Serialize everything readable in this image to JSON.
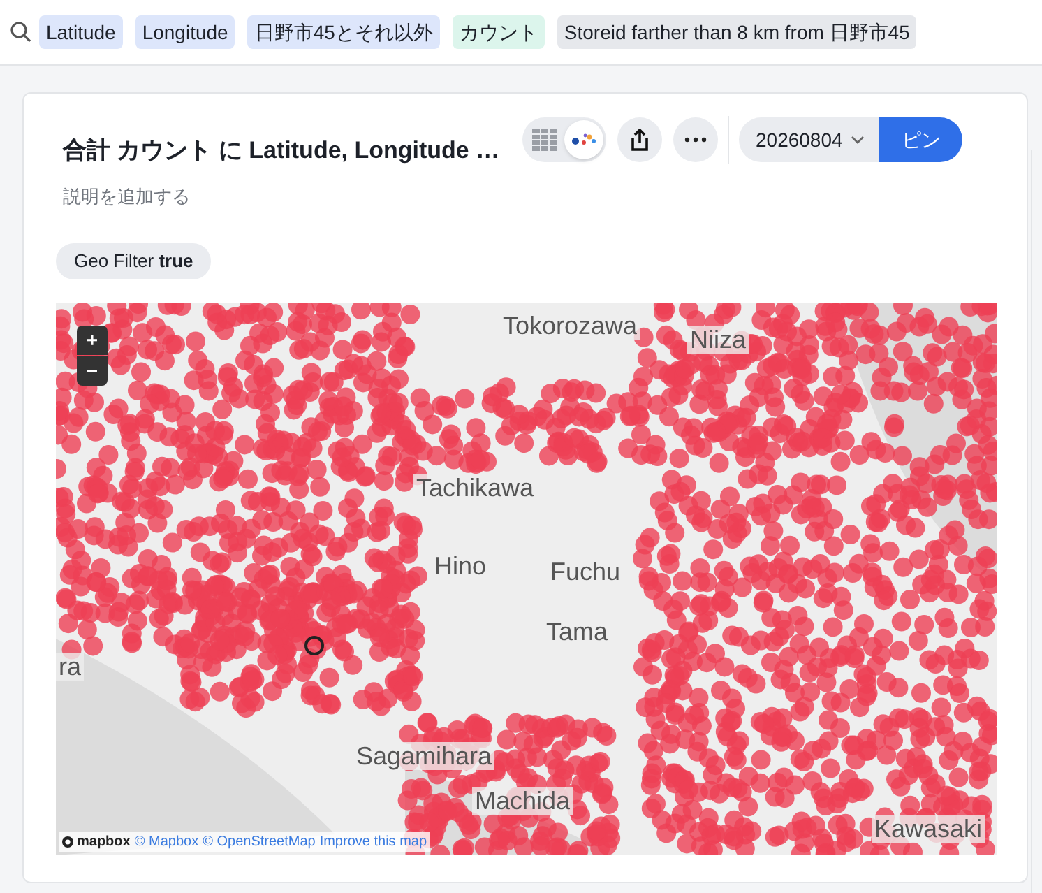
{
  "search_tokens": [
    {
      "label": "Latitude",
      "kind": "column"
    },
    {
      "label": "Longitude",
      "kind": "column"
    },
    {
      "label": "日野市45とそれ以外",
      "kind": "column"
    },
    {
      "label": "カウント",
      "kind": "measure"
    },
    {
      "label": "Storeid farther than 8 km from 日野市45",
      "kind": "filter"
    }
  ],
  "card": {
    "title": "合計 カウント に Latitude, Longitude …",
    "description_placeholder": "説明を追加する",
    "view_toggle": [
      {
        "kind": "table",
        "selected": false
      },
      {
        "kind": "map",
        "selected": true
      }
    ],
    "version": "20260804",
    "pin_button": "ピン",
    "filter_chip": {
      "label": "Geo Filter",
      "value": "true"
    },
    "map": {
      "zoom_in": "+",
      "zoom_out": "−",
      "place_labels": [
        "Tokorozawa",
        "Niiza",
        "Tachikawa",
        "Hino",
        "Fuchu",
        "Tama",
        "Sagamihara",
        "Machida",
        "Kawasaki",
        "ra"
      ],
      "attribution": {
        "logo": "mapbox",
        "links": [
          "© Mapbox",
          "© OpenStreetMap",
          "Improve this map"
        ]
      }
    }
  }
}
